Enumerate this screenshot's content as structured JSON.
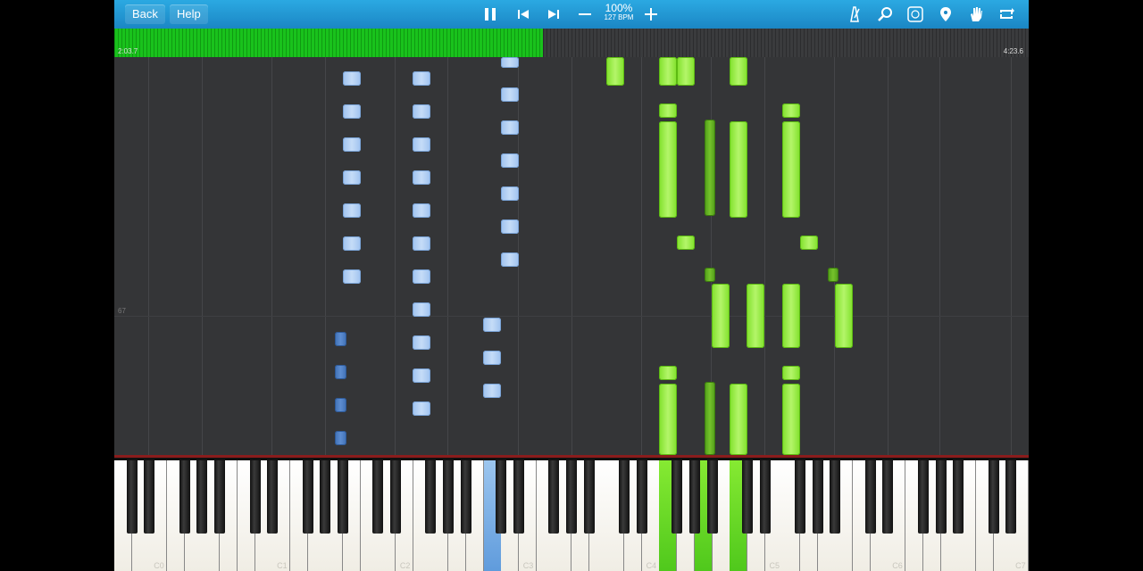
{
  "toolbar": {
    "back_label": "Back",
    "help_label": "Help",
    "speed_percent": "100%",
    "tempo": "127 BPM",
    "icons": [
      "pause-icon",
      "skip-back-icon",
      "skip-forward-icon",
      "minus-icon",
      "plus-icon",
      "metronome-icon",
      "search-icon",
      "label-icon",
      "location-pin-icon",
      "hand-icon",
      "loop-icon"
    ],
    "accent": "#2ba9e2"
  },
  "timeline": {
    "elapsed": "2:03.7",
    "total": "4:23.6",
    "progress_fraction": 0.469,
    "fill_color": "#19c21c"
  },
  "roll": {
    "row_label": "67"
  },
  "keyboard": {
    "octave_labels": [
      "C0",
      "C1",
      "C2",
      "C3",
      "C4",
      "C5",
      "C6",
      "C7"
    ],
    "highlighted_blue_color": "#6fa6e0",
    "highlighted_green_color": "#5fd420"
  }
}
